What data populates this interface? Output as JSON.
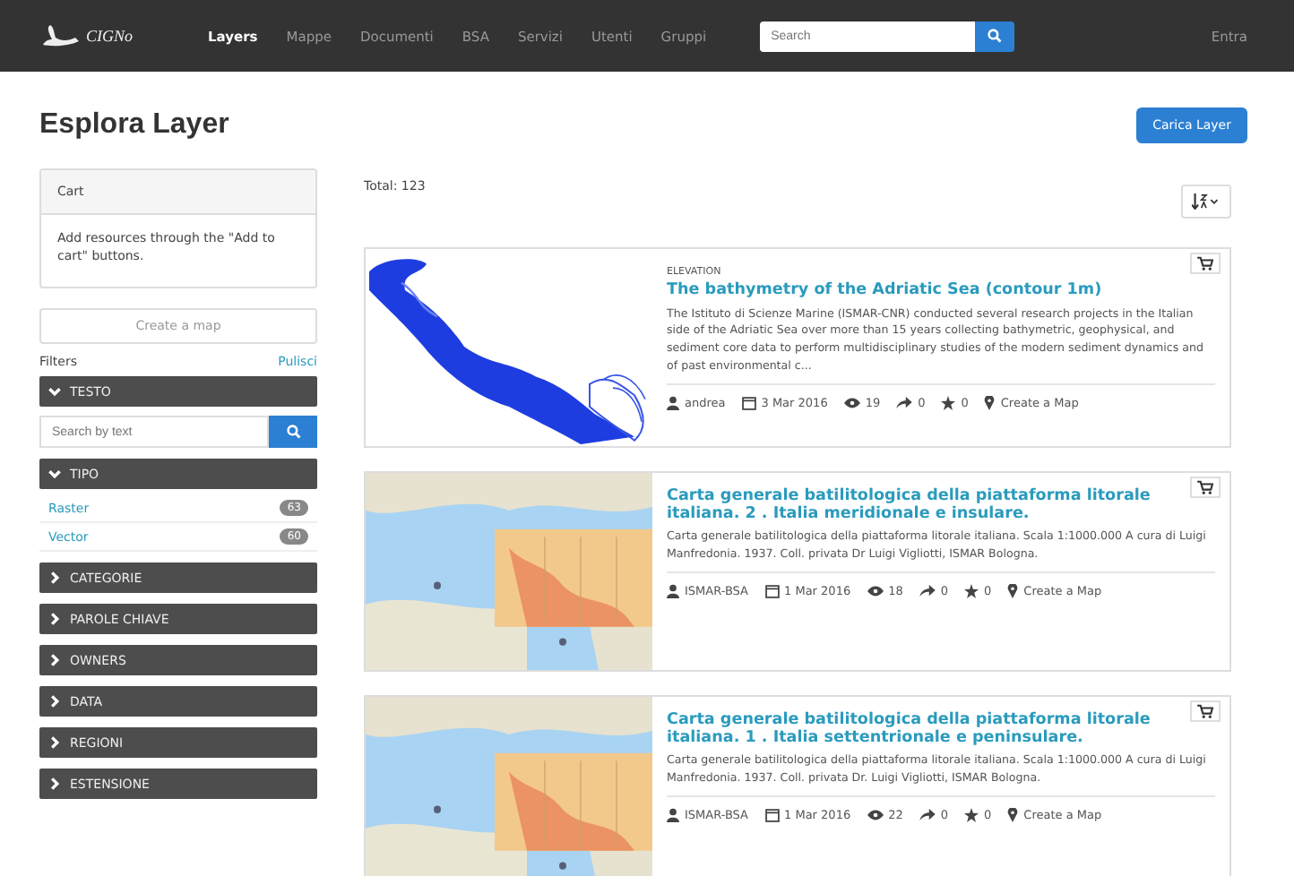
{
  "navbar": {
    "logo": "CIGNo",
    "items": [
      {
        "label": "Layers",
        "selected": true
      },
      {
        "label": "Mappe",
        "selected": false
      },
      {
        "label": "Documenti",
        "selected": false
      },
      {
        "label": "BSA",
        "selected": false
      },
      {
        "label": "Servizi",
        "selected": false
      },
      {
        "label": "Utenti",
        "selected": false
      },
      {
        "label": "Gruppi",
        "selected": false
      }
    ],
    "search": {
      "placeholder": "Search"
    },
    "login": "Entra"
  },
  "page": {
    "title": "Esplora Layer",
    "upload_button": "Carica Layer"
  },
  "sidebar": {
    "cart": {
      "title": "Cart",
      "text": "Add resources through the \"Add to cart\" buttons.",
      "button": "Create a map"
    },
    "filters_label": "Filters",
    "clear_link": "Pulisci",
    "facets": [
      {
        "label": "TESTO",
        "expanded": true,
        "kind": "search",
        "placeholder": "Search by text"
      },
      {
        "label": "TIPO",
        "expanded": true,
        "kind": "list",
        "options": [
          {
            "label": "Raster",
            "count": "63"
          },
          {
            "label": "Vector",
            "count": "60"
          }
        ]
      },
      {
        "label": "CATEGORIE",
        "expanded": false
      },
      {
        "label": "PAROLE CHIAVE",
        "expanded": false
      },
      {
        "label": "OWNERS",
        "expanded": false
      },
      {
        "label": "DATA",
        "expanded": false
      },
      {
        "label": "REGIONI",
        "expanded": false
      },
      {
        "label": "ESTENSIONE",
        "expanded": false
      }
    ]
  },
  "results": {
    "total": "Total: 123",
    "items": [
      {
        "kind": "bathymetry",
        "category": "ELEVATION",
        "title": "The bathymetry of the Adriatic Sea (contour 1m)",
        "abstract": "The Istituto di Scienze Marine (ISMAR-CNR) conducted several research projects in the Italian side of the Adriatic Sea over more than 15 years collecting bathymetric, geophysical, and sediment core data to perform multidisciplinary studies of the modern sediment dynamics and of past environmental c...",
        "owner": "andrea",
        "date": "3 Mar 2016",
        "views": "19",
        "shares": "0",
        "rating": "0",
        "action": "Create a Map"
      },
      {
        "kind": "map",
        "title": "Carta generale batilitologica della piattaforma litorale italiana. 2 . Italia meridionale e insulare.",
        "abstract": "Carta generale batilitologica della piattaforma litorale italiana. Scala 1:1000.000 A cura di Luigi Manfredonia. 1937. Coll. privata Dr Luigi Vigliotti, ISMAR Bologna.",
        "owner": "ISMAR-BSA",
        "date": "1 Mar 2016",
        "views": "18",
        "shares": "0",
        "rating": "0",
        "action": "Create a Map"
      },
      {
        "kind": "map",
        "title": "Carta generale batilitologica della piattaforma litorale italiana. 1 . Italia settentrionale e peninsulare.",
        "abstract": "Carta generale batilitologica della piattaforma litorale italiana. Scala 1:1000.000 A cura di Luigi Manfredonia. 1937. Coll. privata Dr. Luigi Vigliotti, ISMAR Bologna.",
        "owner": "ISMAR-BSA",
        "date": "1 Mar 2016",
        "views": "22",
        "shares": "0",
        "rating": "0",
        "action": "Create a Map"
      }
    ]
  }
}
